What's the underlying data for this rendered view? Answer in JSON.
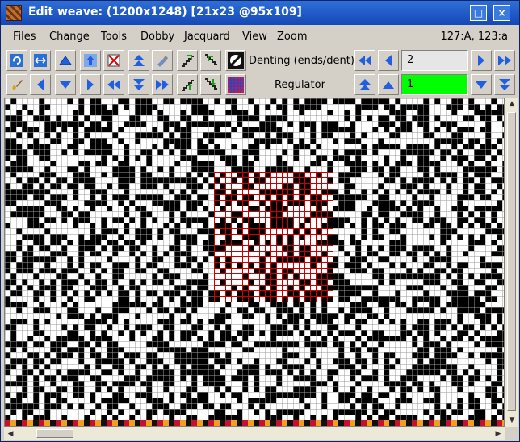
{
  "window": {
    "title": "Edit weave:  (1200x1248) [21x23 @95x109]",
    "controls": [
      "□",
      "×"
    ]
  },
  "menu": {
    "items": [
      "Files",
      "Change",
      "Tools",
      "Dobby",
      "Jacquard",
      "View",
      "Zoom"
    ],
    "cursor_position": "127:A, 123:a"
  },
  "toolbar": {
    "denting_label": "Denting (ends/dent)",
    "denting_value": "2",
    "regulator_label": "Regulator",
    "regulator_value": "1"
  },
  "colors": {
    "selection_border": "#cc0000",
    "regulator_field": "#00ff00",
    "arrow_blue": "#1f5fe0"
  },
  "weave": {
    "selection_cols": 21,
    "selection_rows": 23
  }
}
